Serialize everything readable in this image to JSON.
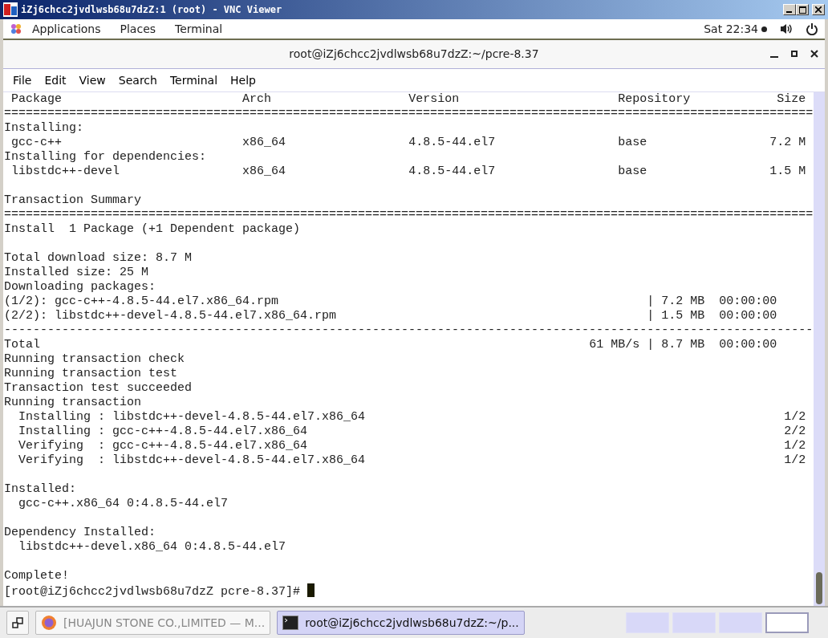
{
  "vnc_window": {
    "title": "iZj6chcc2jvdlwsb68u7dzZ:1 (root) - VNC Viewer"
  },
  "top_bar": {
    "menus": [
      "Applications",
      "Places",
      "Terminal"
    ],
    "clock": "Sat 22:34"
  },
  "terminal": {
    "title": "root@iZj6chcc2jvdlwsb68u7dzZ:~/pcre-8.37",
    "menu": [
      "File",
      "Edit",
      "View",
      "Search",
      "Terminal",
      "Help"
    ],
    "lines": [
      {
        "kind": "row",
        "cells": [
          "Package",
          "Arch",
          "Version",
          "Repository",
          "Size"
        ]
      },
      {
        "kind": "text",
        "text": "================================================================================================================"
      },
      {
        "kind": "text",
        "text": "Installing:"
      },
      {
        "kind": "row",
        "cells": [
          "gcc-c++",
          "x86_64",
          "4.8.5-44.el7",
          "base",
          "7.2 M"
        ]
      },
      {
        "kind": "text",
        "text": "Installing for dependencies:"
      },
      {
        "kind": "row",
        "cells": [
          "libstdc++-devel",
          "x86_64",
          "4.8.5-44.el7",
          "base",
          "1.5 M"
        ]
      },
      {
        "kind": "blank"
      },
      {
        "kind": "text",
        "text": "Transaction Summary"
      },
      {
        "kind": "text",
        "text": "================================================================================================================"
      },
      {
        "kind": "text",
        "text": "Install  1 Package (+1 Dependent package)"
      },
      {
        "kind": "blank"
      },
      {
        "kind": "text",
        "text": "Total download size: 8.7 M"
      },
      {
        "kind": "text",
        "text": "Installed size: 25 M"
      },
      {
        "kind": "text",
        "text": "Downloading packages:"
      },
      {
        "kind": "progress",
        "text": "(1/2): gcc-c++-4.8.5-44.el7.x86_64.rpm",
        "meta": "| 7.2 MB  00:00:00"
      },
      {
        "kind": "progress",
        "text": "(2/2): libstdc++-devel-4.8.5-44.el7.x86_64.rpm",
        "meta": "| 1.5 MB  00:00:00"
      },
      {
        "kind": "text",
        "text": "----------------------------------------------------------------------------------------------------------------"
      },
      {
        "kind": "progress",
        "text": "Total",
        "meta": "61 MB/s | 8.7 MB  00:00:00"
      },
      {
        "kind": "text",
        "text": "Running transaction check"
      },
      {
        "kind": "text",
        "text": "Running transaction test"
      },
      {
        "kind": "text",
        "text": "Transaction test succeeded"
      },
      {
        "kind": "text",
        "text": "Running transaction"
      },
      {
        "kind": "step",
        "text": "  Installing : libstdc++-devel-4.8.5-44.el7.x86_64",
        "count": "1/2"
      },
      {
        "kind": "step",
        "text": "  Installing : gcc-c++-4.8.5-44.el7.x86_64",
        "count": "2/2"
      },
      {
        "kind": "step",
        "text": "  Verifying  : gcc-c++-4.8.5-44.el7.x86_64",
        "count": "1/2"
      },
      {
        "kind": "step",
        "text": "  Verifying  : libstdc++-devel-4.8.5-44.el7.x86_64",
        "count": "1/2"
      },
      {
        "kind": "blank"
      },
      {
        "kind": "text",
        "text": "Installed:"
      },
      {
        "kind": "text",
        "text": "  gcc-c++.x86_64 0:4.8.5-44.el7"
      },
      {
        "kind": "blank"
      },
      {
        "kind": "text",
        "text": "Dependency Installed:"
      },
      {
        "kind": "text",
        "text": "  libstdc++-devel.x86_64 0:4.8.5-44.el7"
      },
      {
        "kind": "blank"
      },
      {
        "kind": "text",
        "text": "Complete!"
      },
      {
        "kind": "prompt",
        "text": "[root@iZj6chcc2jvdlwsb68u7dzZ pcre-8.37]#"
      }
    ]
  },
  "taskbar": {
    "windows": [
      {
        "label": "[HUAJUN STONE CO.,LIMITED — M...",
        "kind": "browser",
        "selected": false
      },
      {
        "label": "root@iZj6chcc2jvdlwsb68u7dzZ:~/p...",
        "kind": "terminal",
        "selected": true
      }
    ],
    "workspaces": [
      {
        "selected": false
      },
      {
        "selected": false
      },
      {
        "selected": false
      },
      {
        "selected": true
      }
    ]
  }
}
